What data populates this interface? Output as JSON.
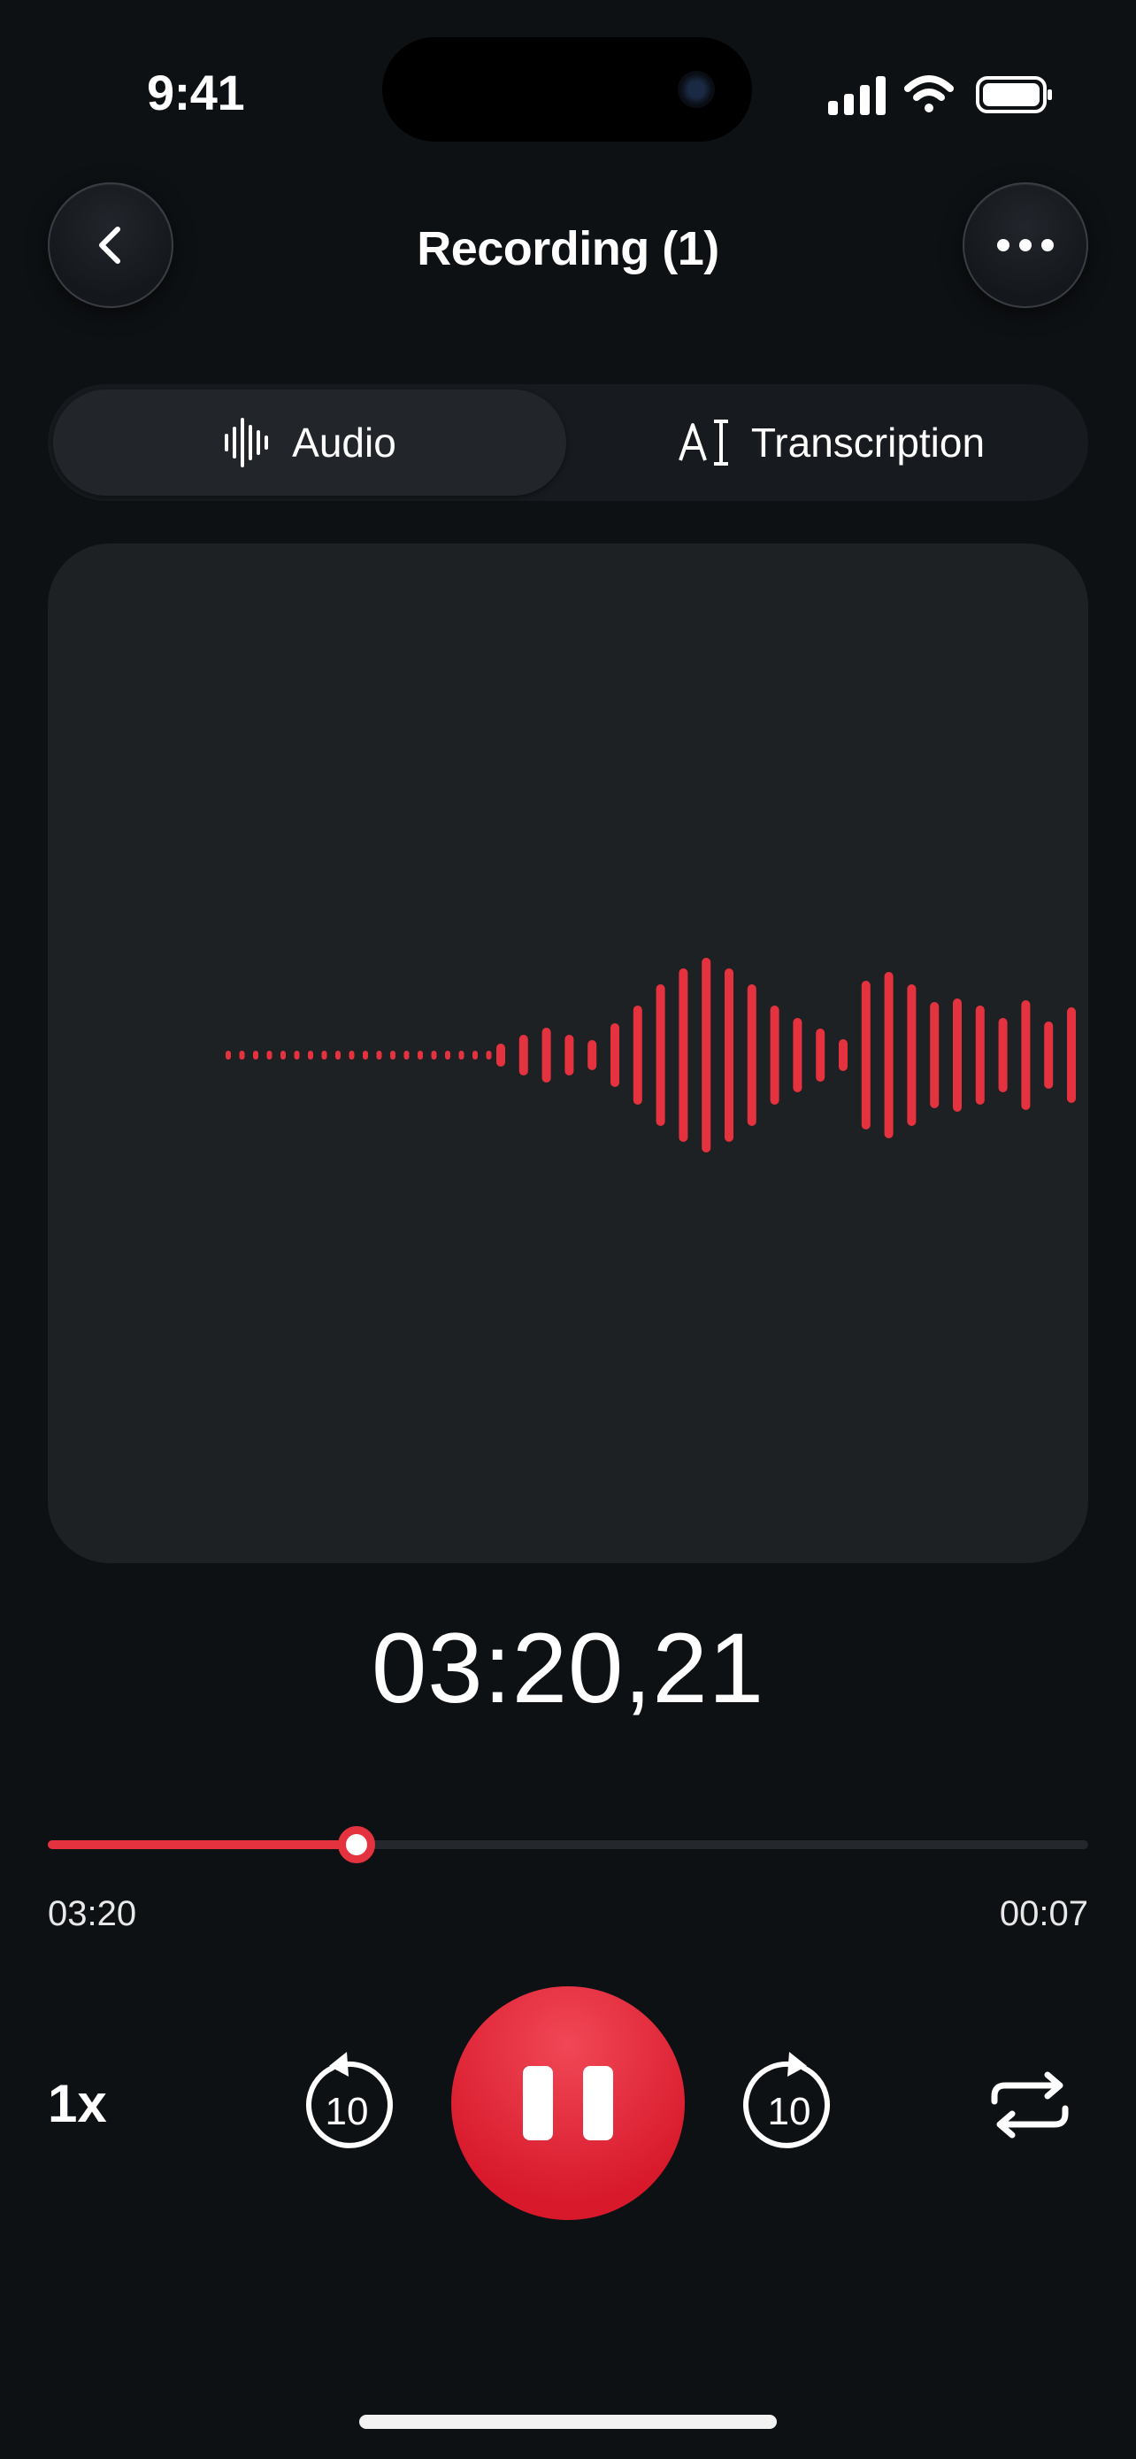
{
  "status_bar": {
    "time": "9:41"
  },
  "header": {
    "title": "Recording (1)"
  },
  "tabs": [
    {
      "label": "Audio",
      "selected": true
    },
    {
      "label": "Transcription",
      "selected": false
    }
  ],
  "player": {
    "timer": "03:20,21",
    "elapsed": "03:20",
    "remaining": "00:07",
    "progress_fraction": 0.297,
    "speed": "1x",
    "skip_seconds": "10"
  },
  "colors": {
    "accent": "#e5323f",
    "background": "#0e1114",
    "card": "#1e2124"
  },
  "icons": [
    "back-icon",
    "more-icon",
    "waveform-icon",
    "text-cursor-icon",
    "rewind-10-icon",
    "pause-icon",
    "forward-10-icon",
    "repeat-icon"
  ]
}
